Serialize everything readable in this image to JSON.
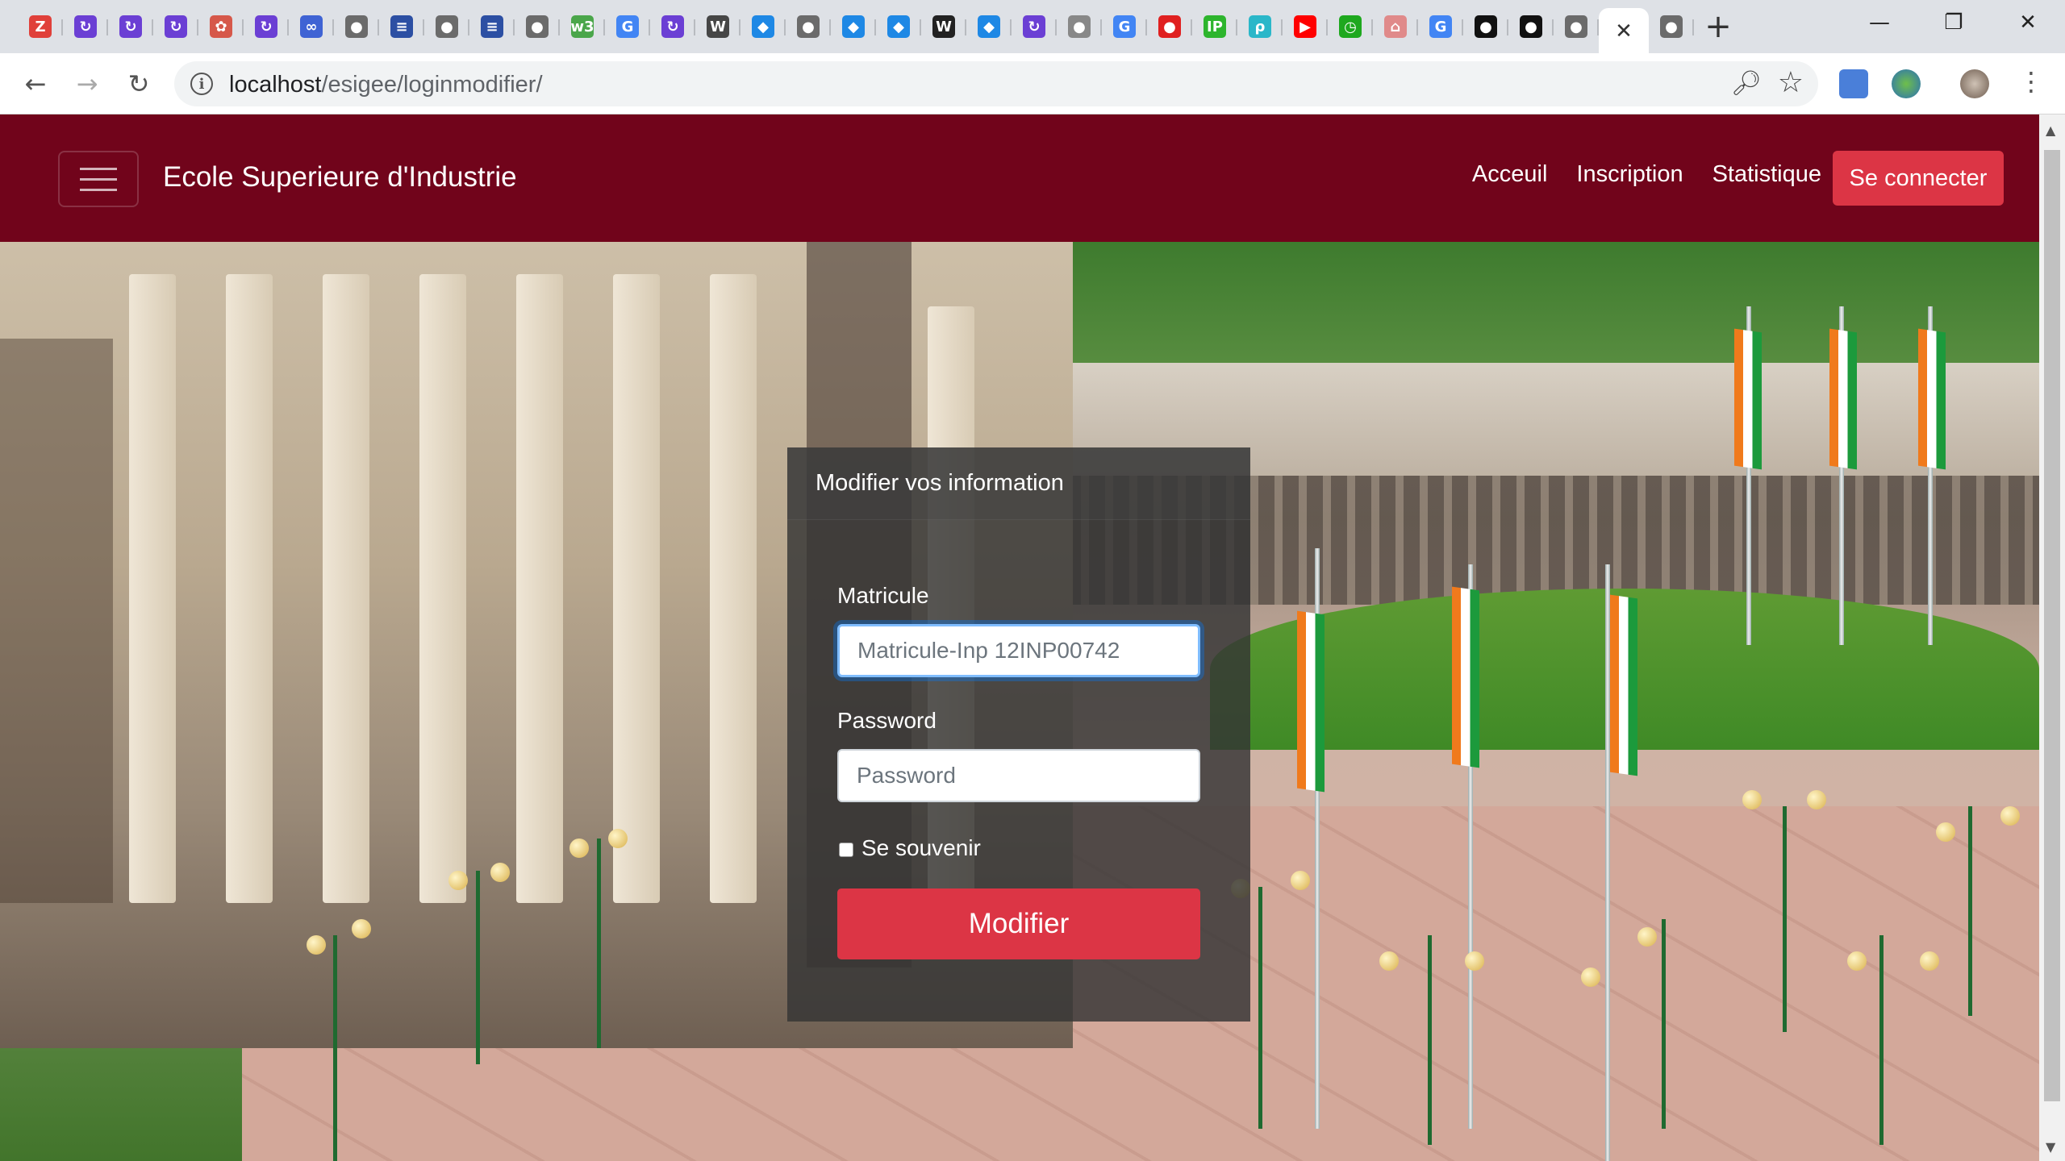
{
  "browser": {
    "tabs": [
      {
        "icon": "zotero-icon",
        "glyph": "Z",
        "color": "#e0403a"
      },
      {
        "icon": "tab-app-icon",
        "glyph": "↻",
        "color": "#6b3fd4"
      },
      {
        "icon": "tab-app-icon",
        "glyph": "↻",
        "color": "#6b3fd4"
      },
      {
        "icon": "tab-app-icon",
        "glyph": "↻",
        "color": "#6b3fd4"
      },
      {
        "icon": "flower-icon",
        "glyph": "✿",
        "color": "#d6584a"
      },
      {
        "icon": "tab-app-icon",
        "glyph": "↻",
        "color": "#6b3fd4"
      },
      {
        "icon": "infinity-icon",
        "glyph": "∞",
        "color": "#3f63d4"
      },
      {
        "icon": "globe-icon",
        "glyph": "●",
        "color": "#6b6b6b"
      },
      {
        "icon": "stack-icon",
        "glyph": "≡",
        "color": "#2c4fa3"
      },
      {
        "icon": "globe-icon",
        "glyph": "●",
        "color": "#6b6b6b"
      },
      {
        "icon": "stack-icon",
        "glyph": "≡",
        "color": "#2c4fa3"
      },
      {
        "icon": "globe-icon",
        "glyph": "●",
        "color": "#6b6b6b"
      },
      {
        "icon": "w3c-icon",
        "glyph": "w3",
        "color": "#4aa64a"
      },
      {
        "icon": "google-icon",
        "glyph": "G",
        "color": "#4285f4"
      },
      {
        "icon": "tab-app-icon",
        "glyph": "↻",
        "color": "#6b3fd4"
      },
      {
        "icon": "wordpress-icon",
        "glyph": "W",
        "color": "#464646"
      },
      {
        "icon": "ghost-icon",
        "glyph": "◆",
        "color": "#1e88e5"
      },
      {
        "icon": "globe-icon",
        "glyph": "●",
        "color": "#6b6b6b"
      },
      {
        "icon": "ghost-icon",
        "glyph": "◆",
        "color": "#1e88e5"
      },
      {
        "icon": "ghost-icon",
        "glyph": "◆",
        "color": "#1e88e5"
      },
      {
        "icon": "wikipedia-icon",
        "glyph": "W",
        "color": "#222222"
      },
      {
        "icon": "ghost-icon",
        "glyph": "◆",
        "color": "#1e88e5"
      },
      {
        "icon": "tab-app-icon",
        "glyph": "↻",
        "color": "#6b3fd4"
      },
      {
        "icon": "disc-icon",
        "glyph": "●",
        "color": "#888888"
      },
      {
        "icon": "google-icon",
        "glyph": "G",
        "color": "#4285f4"
      },
      {
        "icon": "pin-icon",
        "glyph": "●",
        "color": "#e02020"
      },
      {
        "icon": "ip-icon",
        "glyph": "IP",
        "color": "#2db52d"
      },
      {
        "icon": "tp-link-icon",
        "glyph": "ρ",
        "color": "#2ab7c9"
      },
      {
        "icon": "youtube-icon",
        "glyph": "▶",
        "color": "#ff0000"
      },
      {
        "icon": "clock-icon",
        "glyph": "◷",
        "color": "#1ea81e"
      },
      {
        "icon": "person-icon",
        "glyph": "⌂",
        "color": "#e08a8a"
      },
      {
        "icon": "google-icon",
        "glyph": "G",
        "color": "#4285f4"
      },
      {
        "icon": "github-icon",
        "glyph": "●",
        "color": "#111111"
      },
      {
        "icon": "github-icon",
        "glyph": "●",
        "color": "#111111"
      },
      {
        "icon": "globe-icon",
        "glyph": "●",
        "color": "#6b6b6b"
      }
    ],
    "active_tab_close": "✕",
    "after_tabs": {
      "icon": "globe-icon",
      "glyph": "●",
      "color": "#6b6b6b"
    },
    "new_tab": "+",
    "window_controls": {
      "minimize": "—",
      "restore": "❐",
      "close": "✕"
    },
    "nav": {
      "back": "←",
      "forward": "→",
      "reload": "↻"
    },
    "url_host": "localhost",
    "url_path": "/esigee/loginmodifier/"
  },
  "navbar": {
    "brand": "Ecole Superieure d'Industrie",
    "links": [
      "Acceuil",
      "Inscription",
      "Statistique"
    ],
    "login_button": "Se connecter"
  },
  "form": {
    "title": "Modifier vos information",
    "matricule_label": "Matricule",
    "matricule_placeholder": "Matricule-Inp 12INP00742",
    "password_label": "Password",
    "password_placeholder": "Password",
    "remember_label": "Se souvenir",
    "submit_label": "Modifier"
  },
  "colors": {
    "navbar_bg": "#71041b",
    "primary_button": "#dc3545",
    "card_bg": "rgba(52,52,52,0.82)"
  }
}
